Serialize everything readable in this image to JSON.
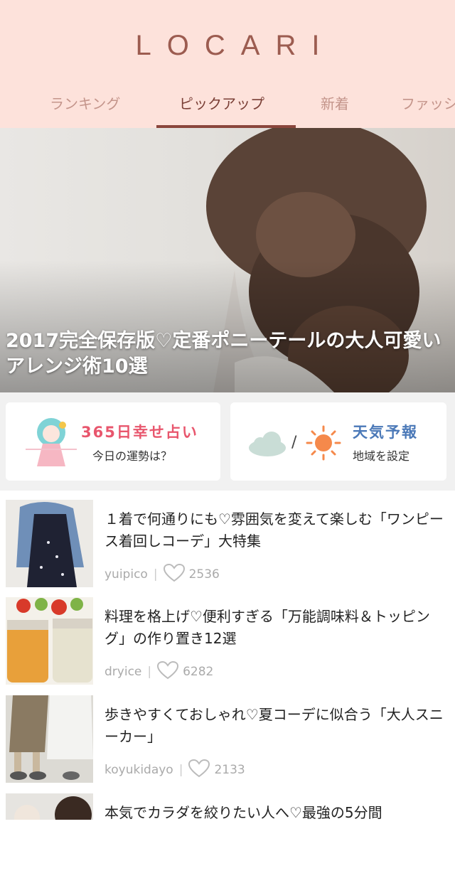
{
  "header": {
    "logo": "LOCARI",
    "tabs": [
      {
        "label": "ランキング",
        "active": false
      },
      {
        "label": "ピックアップ",
        "active": true
      },
      {
        "label": "新着",
        "active": false
      },
      {
        "label": "ファッシ",
        "active": false
      }
    ]
  },
  "hero": {
    "title": "2017完全保存版♡定番ポニーテールの大人可愛いアレンジ術10選"
  },
  "cards": {
    "fortune": {
      "title": "365日幸せ占い",
      "subtitle": "今日の運勢は？"
    },
    "weather": {
      "title": "天気予報",
      "subtitle": "地域を設定",
      "separator": "/"
    }
  },
  "articles": [
    {
      "title": "１着で何通りにも♡雰囲気を変えて楽しむ「ワンピース着回しコーデ」大特集",
      "author": "yuipico",
      "likes": "2536"
    },
    {
      "title": "料理を格上げ♡便利すぎる「万能調味料＆トッピング」の作り置き12選",
      "author": "dryice",
      "likes": "6282"
    },
    {
      "title": "歩きやすくておしゃれ♡夏コーデに似合う「大人スニーカー」",
      "author": "koyukidayo",
      "likes": "2133"
    },
    {
      "title": "本気でカラダを絞りたい人へ♡最強の5分間"
    }
  ],
  "colors": {
    "header_bg": "#fde2db",
    "accent": "#8a463c",
    "fortune": "#e8566d",
    "weather": "#4b79b8"
  },
  "icons": [
    "fortune-girl-icon",
    "cloud-icon",
    "sun-icon",
    "heart-icon"
  ]
}
